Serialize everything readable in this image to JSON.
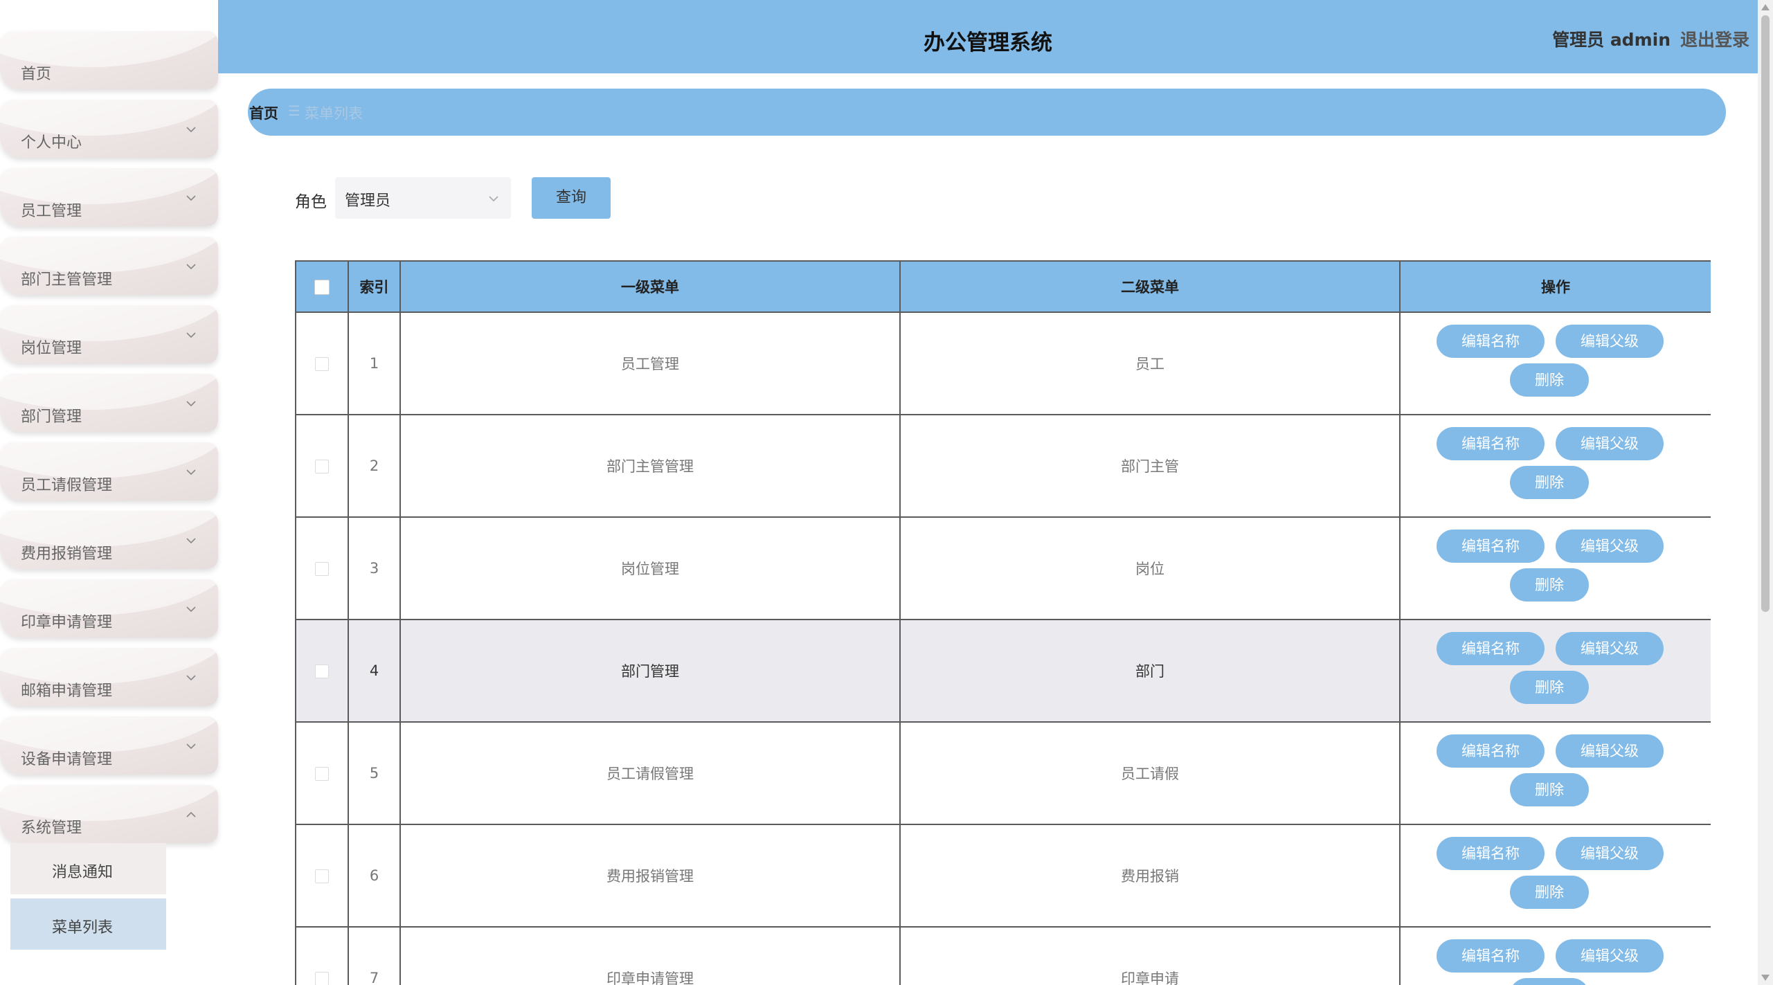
{
  "header": {
    "title": "办公管理系统",
    "user": "管理员 admin",
    "logout": "退出登录"
  },
  "sidebar": {
    "items": [
      {
        "label": "首页"
      },
      {
        "label": "个人中心"
      },
      {
        "label": "员工管理"
      },
      {
        "label": "部门主管管理"
      },
      {
        "label": "岗位管理"
      },
      {
        "label": "部门管理"
      },
      {
        "label": "员工请假管理"
      },
      {
        "label": "费用报销管理"
      },
      {
        "label": "印章申请管理"
      },
      {
        "label": "邮箱申请管理"
      },
      {
        "label": "设备申请管理"
      },
      {
        "label": "系统管理"
      }
    ],
    "submenu": [
      {
        "label": "消息通知"
      },
      {
        "label": "菜单列表"
      }
    ]
  },
  "breadcrumb": {
    "home": "首页",
    "separator": "☰",
    "current": "菜单列表"
  },
  "search": {
    "role_label": "角色",
    "role_value": "管理员",
    "query_button": "查询"
  },
  "table": {
    "headers": [
      "",
      "索引",
      "一级菜单",
      "二级菜单",
      "操作"
    ],
    "rows": [
      {
        "index": "1",
        "menu1": "员工管理",
        "menu2": "员工"
      },
      {
        "index": "2",
        "menu1": "部门主管管理",
        "menu2": "部门主管"
      },
      {
        "index": "3",
        "menu1": "岗位管理",
        "menu2": "岗位"
      },
      {
        "index": "4",
        "menu1": "部门管理",
        "menu2": "部门"
      },
      {
        "index": "5",
        "menu1": "员工请假管理",
        "menu2": "员工请假"
      },
      {
        "index": "6",
        "menu1": "费用报销管理",
        "menu2": "费用报销"
      },
      {
        "index": "7",
        "menu1": "印章申请管理",
        "menu2": "印章申请"
      }
    ],
    "actions": {
      "edit_name": "编辑名称",
      "edit_parent": "编辑父级",
      "delete": "删除"
    }
  },
  "colors": {
    "primary": "#82bbe8",
    "active_submenu": "#cfdfee",
    "row_hover": "#ebebef",
    "submenu_bg": "#f2eded"
  }
}
